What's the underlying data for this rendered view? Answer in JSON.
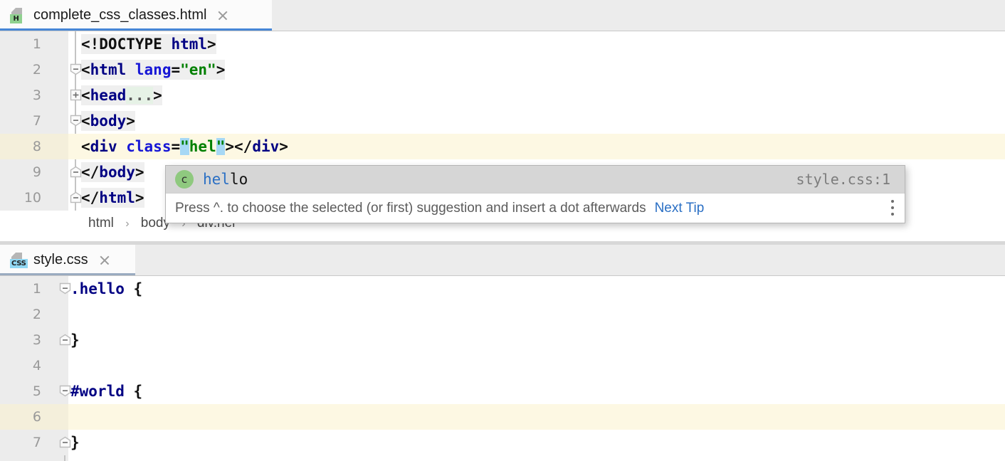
{
  "editors": [
    {
      "id": "html-editor",
      "tab": {
        "title": "complete_css_classes.html",
        "icon": "html-file-icon",
        "badge": "H",
        "badge_color": "#8fd18f",
        "close_icon": "close-icon",
        "active": true,
        "underline_color": "#4786d6"
      },
      "lines": [
        {
          "no": "1",
          "fold": "none",
          "caret": false
        },
        {
          "no": "2",
          "fold": "minus",
          "caret": false
        },
        {
          "no": "3",
          "fold": "plus",
          "caret": false
        },
        {
          "no": "7",
          "fold": "minus",
          "caret": false
        },
        {
          "no": "8",
          "fold": "none",
          "caret": true
        },
        {
          "no": "9",
          "fold": "end",
          "caret": false
        },
        {
          "no": "10",
          "fold": "end",
          "caret": false
        }
      ],
      "code_text": [
        "<!DOCTYPE html>",
        "<html lang=\"en\">",
        "<head...>",
        "<body>",
        "<div class=\"hel\"></div>",
        "</body>",
        "</html>"
      ],
      "breadcrumb": [
        "html",
        "body",
        "div.hel"
      ],
      "breadcrumb_separator": "›"
    },
    {
      "id": "css-editor",
      "tab": {
        "title": "style.css",
        "icon": "css-file-icon",
        "badge": "CSS",
        "badge_color": "#91d7f2",
        "close_icon": "close-icon",
        "active": false,
        "underline_color": "#9aabc0"
      },
      "lines": [
        {
          "no": "1",
          "fold": "minus",
          "caret": false
        },
        {
          "no": "2",
          "fold": "none",
          "caret": false
        },
        {
          "no": "3",
          "fold": "end",
          "caret": false
        },
        {
          "no": "4",
          "fold": "none",
          "caret": false
        },
        {
          "no": "5",
          "fold": "minus",
          "caret": false
        },
        {
          "no": "6",
          "fold": "none",
          "caret": true
        },
        {
          "no": "7",
          "fold": "end",
          "caret": false
        }
      ],
      "code_text": [
        ".hello {",
        "",
        "}",
        "",
        "#world {",
        "",
        "}"
      ]
    }
  ],
  "completion_popup": {
    "item": {
      "symbol_icon": "css-class-symbol-icon",
      "symbol_letter": "c",
      "matched_prefix": "hel",
      "remainder": "lo",
      "full_label": "hello",
      "origin": "style.css:1"
    },
    "tip": {
      "text": "Press ^. to choose the selected (or first) suggestion and insert a dot afterwards",
      "link": "Next Tip",
      "menu_icon": "more-options-icon"
    }
  },
  "colors": {
    "tag": "#000083",
    "attribute": "#1717d6",
    "string": "#008000",
    "selection": "#a6d8f5",
    "caret_line": "#fdf8e3",
    "link": "#2a6fc4"
  }
}
